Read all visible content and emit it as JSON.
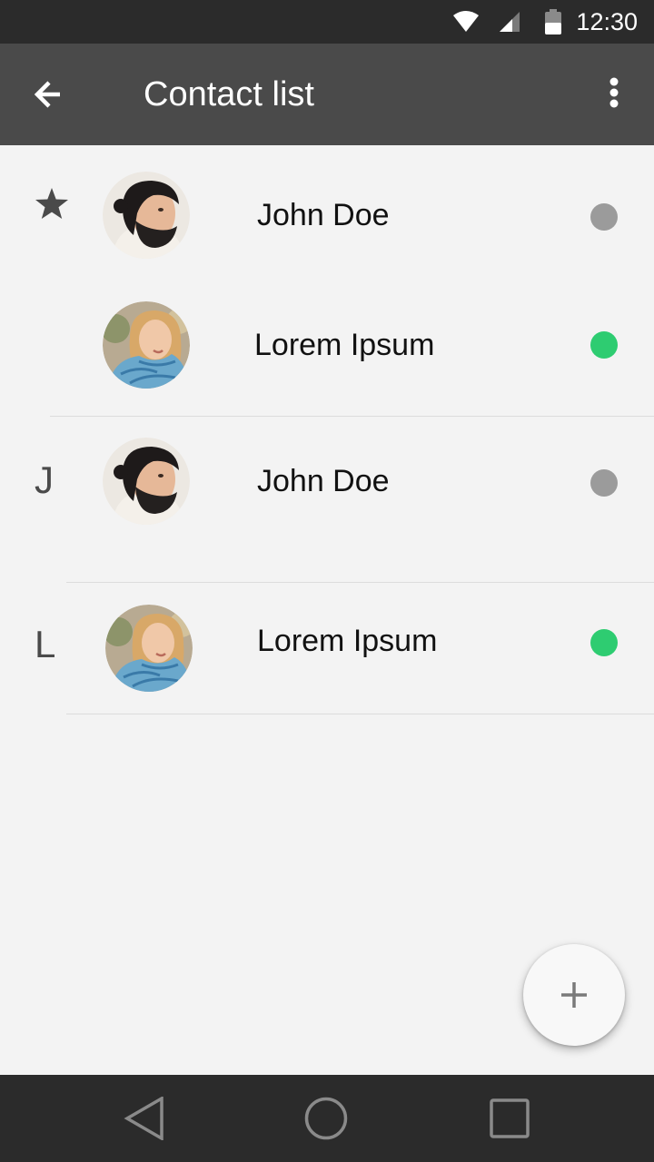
{
  "status_bar": {
    "time": "12:30",
    "icons": [
      "wifi-icon",
      "signal-icon",
      "battery-icon"
    ]
  },
  "app_bar": {
    "title": "Contact list",
    "back_icon": "arrow-left-icon",
    "menu_icon": "more-vert-icon"
  },
  "contacts": [
    {
      "section": "favorites",
      "section_icon": "star-icon",
      "name": "John Doe",
      "status": "offline",
      "avatar": "man-avatar"
    },
    {
      "section": "favorites",
      "name": "Lorem Ipsum",
      "status": "online",
      "avatar": "woman-avatar"
    },
    {
      "section": "J",
      "section_label": "J",
      "name": "John Doe",
      "status": "offline",
      "avatar": "man-avatar"
    },
    {
      "section": "L",
      "section_label": "L",
      "name": "Lorem Ipsum",
      "status": "online",
      "avatar": "woman-avatar"
    }
  ],
  "colors": {
    "app_bar": "#4a4a4a",
    "status_bar": "#2b2b2b",
    "background": "#f3f3f3",
    "online": "#2ecc71",
    "offline": "#9b9b9b"
  },
  "fab": {
    "icon": "plus-icon"
  },
  "nav_bar": {
    "icons": [
      "back-triangle-icon",
      "home-circle-icon",
      "recents-square-icon"
    ]
  }
}
